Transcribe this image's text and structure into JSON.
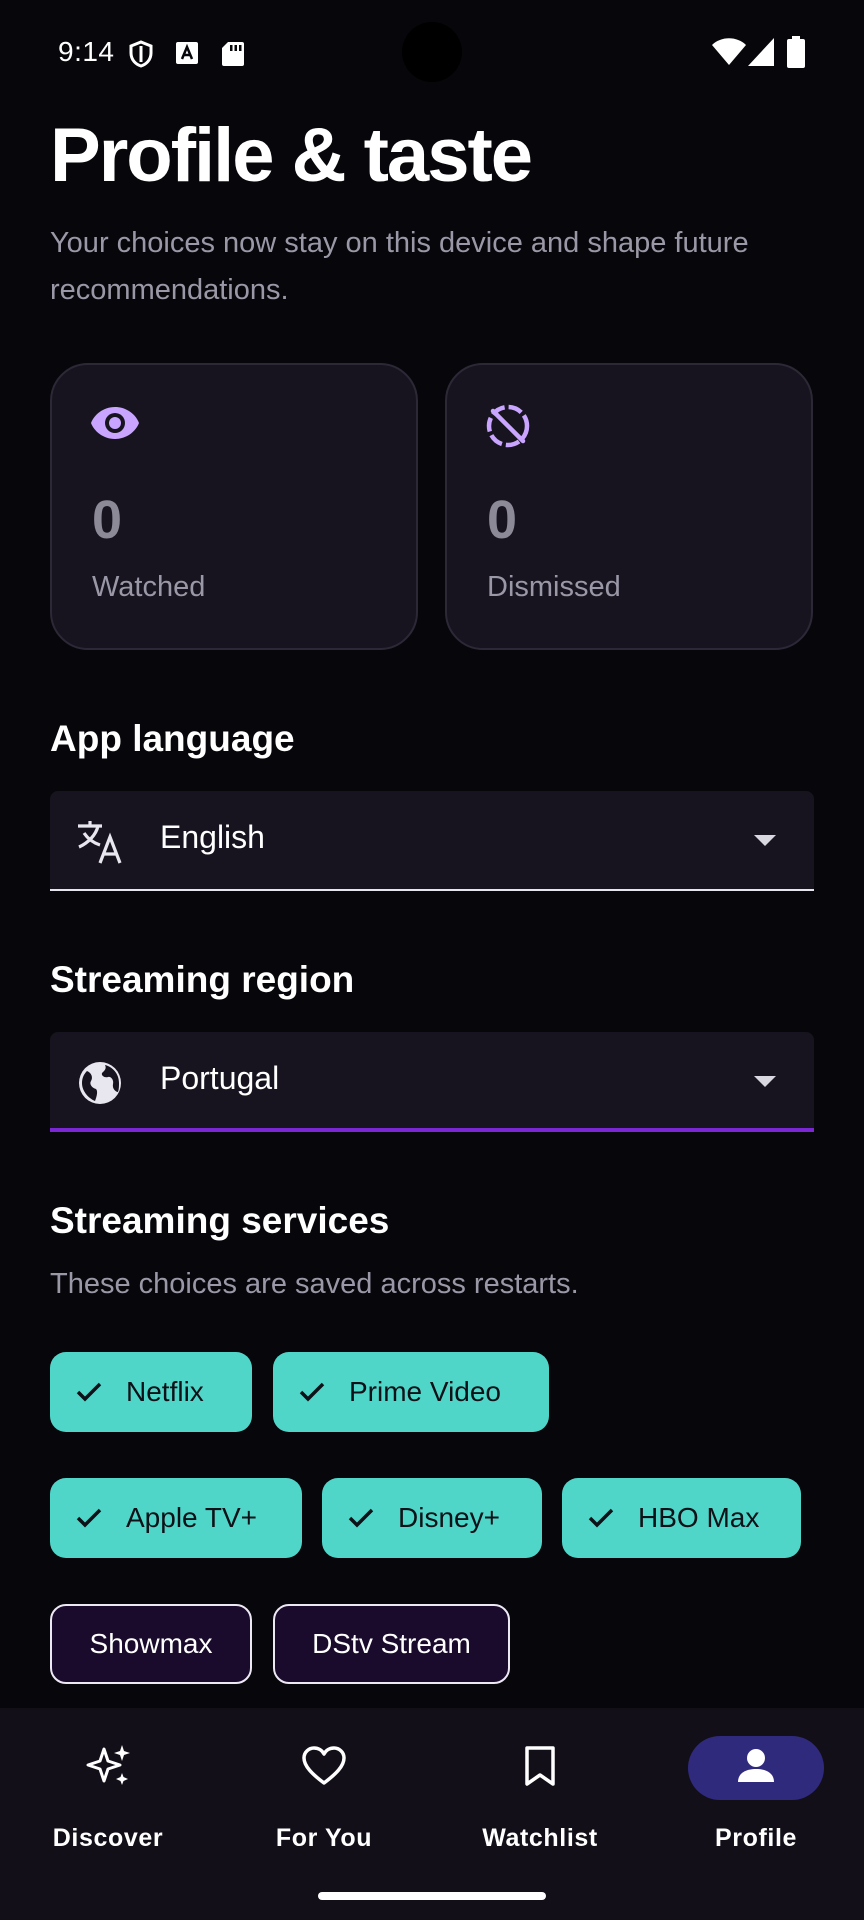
{
  "status_bar": {
    "time": "9:14"
  },
  "header": {
    "title": "Profile & taste",
    "subtitle": "Your choices now stay on this device and shape future recommendations."
  },
  "stats": [
    {
      "value": "0",
      "label": "Watched",
      "icon": "eye-icon"
    },
    {
      "value": "0",
      "label": "Dismissed",
      "icon": "eye-off-icon"
    }
  ],
  "language": {
    "heading": "App language",
    "value": "English",
    "icon": "translate-icon"
  },
  "region": {
    "heading": "Streaming region",
    "value": "Portugal",
    "icon": "globe-icon"
  },
  "services": {
    "heading": "Streaming services",
    "note": "These choices are saved across restarts.",
    "chips": [
      {
        "label": "Netflix",
        "selected": true
      },
      {
        "label": "Prime Video",
        "selected": true
      },
      {
        "label": "Apple TV+",
        "selected": true
      },
      {
        "label": "Disney+",
        "selected": true
      },
      {
        "label": "HBO Max",
        "selected": true
      },
      {
        "label": "Showmax",
        "selected": false
      },
      {
        "label": "DStv Stream",
        "selected": false
      }
    ]
  },
  "nav": [
    {
      "label": "Discover",
      "icon": "sparkles-icon",
      "active": false
    },
    {
      "label": "For You",
      "icon": "heart-icon",
      "active": false
    },
    {
      "label": "Watchlist",
      "icon": "bookmark-icon",
      "active": false
    },
    {
      "label": "Profile",
      "icon": "person-icon",
      "active": true
    }
  ],
  "colors": {
    "accent_teal": "#4fd6c9",
    "accent_purple": "#7b28d4",
    "icon_lavender": "#c9a5ff",
    "nav_active": "#2f2a7c"
  }
}
